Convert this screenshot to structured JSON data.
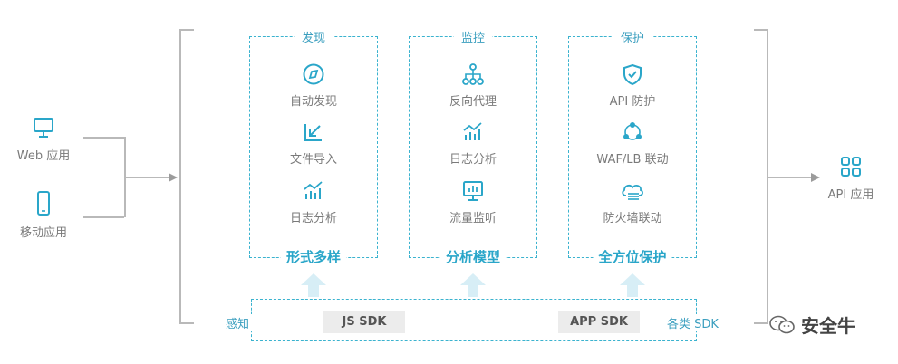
{
  "clients": {
    "web_label": "Web 应用",
    "mobile_label": "移动应用"
  },
  "columns": {
    "discover": {
      "title": "发现",
      "items": [
        "自动发现",
        "文件导入",
        "日志分析"
      ],
      "footer": "形式多样"
    },
    "monitor": {
      "title": "监控",
      "items": [
        "反向代理",
        "日志分析",
        "流量监听"
      ],
      "footer": "分析模型"
    },
    "protect": {
      "title": "保护",
      "items": [
        "API 防护",
        "WAF/LB 联动",
        "防火墙联动"
      ],
      "footer": "全方位保护"
    }
  },
  "sdk": {
    "left_label": "感知",
    "js": "JS SDK",
    "app": "APP SDK",
    "right_label": "各类 SDK"
  },
  "output": {
    "label": "API 应用"
  },
  "watermark": {
    "text": "安全牛"
  },
  "colors": {
    "accent": "#2aa6c9",
    "arrow_fill": "#d7eef6",
    "line": "#b9b9b9"
  }
}
